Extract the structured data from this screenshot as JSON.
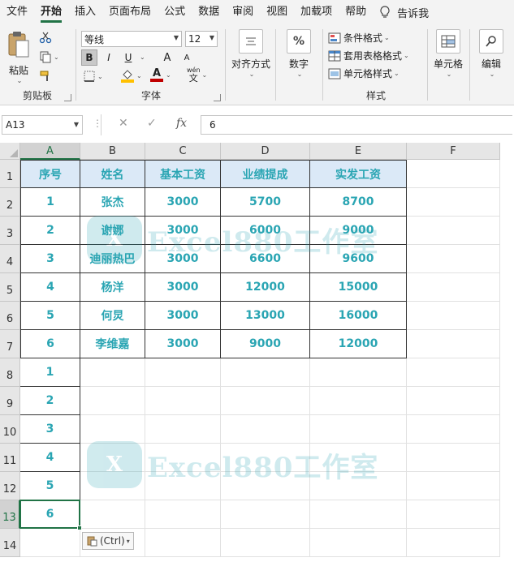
{
  "menu": {
    "tabs": [
      "文件",
      "开始",
      "插入",
      "页面布局",
      "公式",
      "数据",
      "审阅",
      "视图",
      "加载项",
      "帮助"
    ],
    "active": "开始",
    "tell_me": "告诉我"
  },
  "ribbon": {
    "clipboard": {
      "paste_label": "粘贴",
      "group_label": "剪贴板"
    },
    "font": {
      "font_name": "等线",
      "font_size": "12",
      "bold": "B",
      "italic": "I",
      "underline": "U",
      "grow": "A",
      "shrink": "A",
      "color_letter": "A",
      "phonetic_top": "wén",
      "phonetic_bottom": "文",
      "group_label": "字体",
      "fill_color": "#ffc000",
      "font_color": "#c00000"
    },
    "alignment": {
      "label": "对齐方式"
    },
    "number": {
      "label": "数字",
      "symbol": "%"
    },
    "styles": {
      "conditional": "条件格式",
      "table": "套用表格格式",
      "cell_styles": "单元格样式",
      "group_label": "样式"
    },
    "cells": {
      "label": "单元格"
    },
    "editing": {
      "label": "编辑"
    }
  },
  "formula_bar": {
    "name_box": "A13",
    "cancel": "✕",
    "enter": "✓",
    "fx": "fx",
    "content": "6"
  },
  "sheet": {
    "columns": [
      "A",
      "B",
      "C",
      "D",
      "E",
      "F"
    ],
    "rows": [
      "1",
      "2",
      "3",
      "4",
      "5",
      "6",
      "7",
      "8",
      "9",
      "10",
      "11",
      "12",
      "13",
      "14"
    ],
    "selected_col": "A",
    "selected_row": "13",
    "header": [
      "序号",
      "姓名",
      "基本工资",
      "业绩提成",
      "实发工资"
    ],
    "data": [
      [
        "1",
        "张杰",
        "3000",
        "5700",
        "8700"
      ],
      [
        "2",
        "谢娜",
        "3000",
        "6000",
        "9000"
      ],
      [
        "3",
        "迪丽热巴",
        "3000",
        "6600",
        "9600"
      ],
      [
        "4",
        "杨洋",
        "3000",
        "12000",
        "15000"
      ],
      [
        "5",
        "何炅",
        "3000",
        "13000",
        "16000"
      ],
      [
        "6",
        "李维嘉",
        "3000",
        "9000",
        "12000"
      ]
    ],
    "extra_a": [
      "1",
      "2",
      "3",
      "4",
      "5",
      "6"
    ],
    "accent_color": "#2aa5b3",
    "header_fill": "#dbe9f7"
  },
  "watermark": {
    "badge": "X",
    "text": "Excel880工作室"
  },
  "paste_options": {
    "label": "(Ctrl)"
  }
}
